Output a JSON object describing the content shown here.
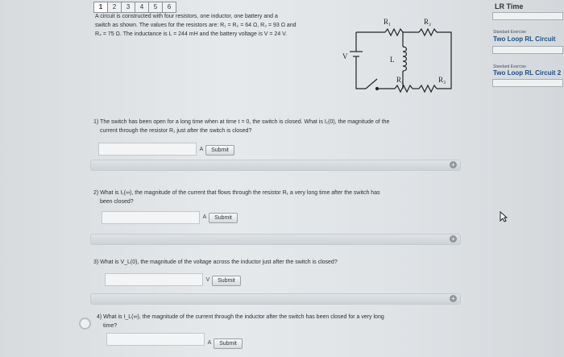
{
  "tabs": [
    "1",
    "2",
    "3",
    "4",
    "5",
    "6"
  ],
  "active_tab_index": 0,
  "intro": {
    "line1": "A circuit is constructed with four resistors, one inductor, one battery and a",
    "line2": "switch as shown. The values for the resistors are: R₁ = R₂ = 64 Ω, R₃ = 93 Ω and",
    "line3": "R₄ = 75 Ω. The inductance is L = 244 mH and the battery voltage is V = 24 V."
  },
  "circuit": {
    "r1": "R₁",
    "r2": "R₂",
    "r3": "R₃",
    "r4": "R₄",
    "v": "V",
    "l": "L"
  },
  "questions": [
    {
      "text1": "1) The switch has been open for a long time when at time t = 0, the switch is closed. What is I₁(0), the magnitude of the",
      "text2": "current through the resistor R₁ just after the switch is closed?",
      "unit": "A",
      "submit": "Submit"
    },
    {
      "text1": "2) What is I₁(∞), the magnitude of the current that flows through the resistor R₁ a very long time after the switch has",
      "text2": "been closed?",
      "unit": "A",
      "submit": "Submit"
    },
    {
      "text1": "3) What is V_L(0), the magnitude of the voltage across the inductor just after the switch is closed?",
      "text2": "",
      "unit": "V",
      "submit": "Submit"
    },
    {
      "text1": "4) What is I_L(∞), the magnitude of the current through the inductor after the switch has been closed for a very long",
      "text2": "time?",
      "unit": "A",
      "submit": "Submit"
    }
  ],
  "sidebar": {
    "title": "LR Time",
    "items": [
      {
        "label": "Standard Exercise",
        "link": "Two Loop RL Circuit"
      },
      {
        "label": "Standard Exercise",
        "link": "Two Loop RL Circuit 2"
      }
    ]
  },
  "colors": {
    "link": "#1c4f88",
    "text": "#2b2f33",
    "bar": "#cdd2d6"
  }
}
